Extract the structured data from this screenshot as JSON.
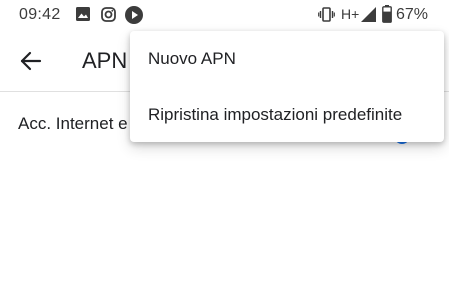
{
  "status_bar": {
    "time": "09:42",
    "battery": "67%",
    "network": "H+",
    "icons": [
      "image-icon",
      "instagram-icon",
      "play-icon",
      "vibrate-icon",
      "signal-icon",
      "battery-icon"
    ]
  },
  "toolbar": {
    "title": "APN",
    "back_icon": "arrow-back-icon"
  },
  "list": {
    "items": [
      {
        "label": "Acc. Internet e"
      }
    ]
  },
  "overflow_menu": {
    "items": [
      {
        "label": "Nuovo APN"
      },
      {
        "label": "Ripristina impostazioni predefinite"
      }
    ]
  },
  "colors": {
    "accent": "#1a73e8",
    "icon": "#3c3c3c",
    "text": "#202124"
  }
}
